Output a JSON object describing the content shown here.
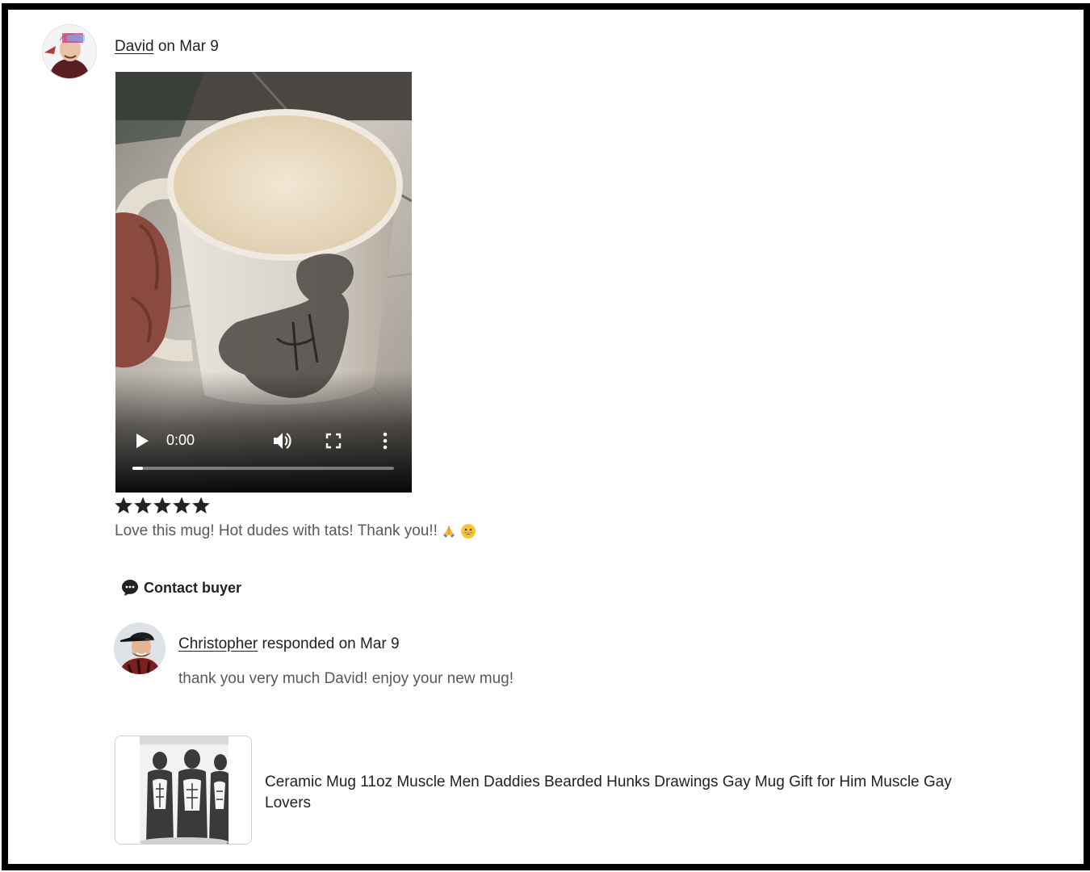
{
  "review": {
    "reviewer_name": "David",
    "date_text": "on Mar 9",
    "rating": 5,
    "rating_max": 5,
    "text": "Love this mug! Hot dudes with tats! Thank you!!",
    "emojis": [
      "folded-hands-emoji",
      "grinning-face-emoji"
    ]
  },
  "video": {
    "time": "0:00",
    "progress": 0.04,
    "icons": [
      "play-icon",
      "volume-icon",
      "fullscreen-icon",
      "more-vert-icon"
    ]
  },
  "actions": {
    "contact_buyer_label": "Contact buyer",
    "contact_icon": "chat-bubble-icon"
  },
  "response": {
    "responder_name": "Christopher",
    "meta_text": "responded on Mar 9",
    "text": "thank you very much David! enjoy your new mug!"
  },
  "product": {
    "title": "Ceramic Mug 11oz Muscle Men Daddies Bearded Hunks Drawings Gay Mug Gift for Him Muscle Gay Lovers"
  },
  "colors": {
    "text_primary": "#222222",
    "text_secondary": "#595959",
    "frame": "#000000"
  }
}
